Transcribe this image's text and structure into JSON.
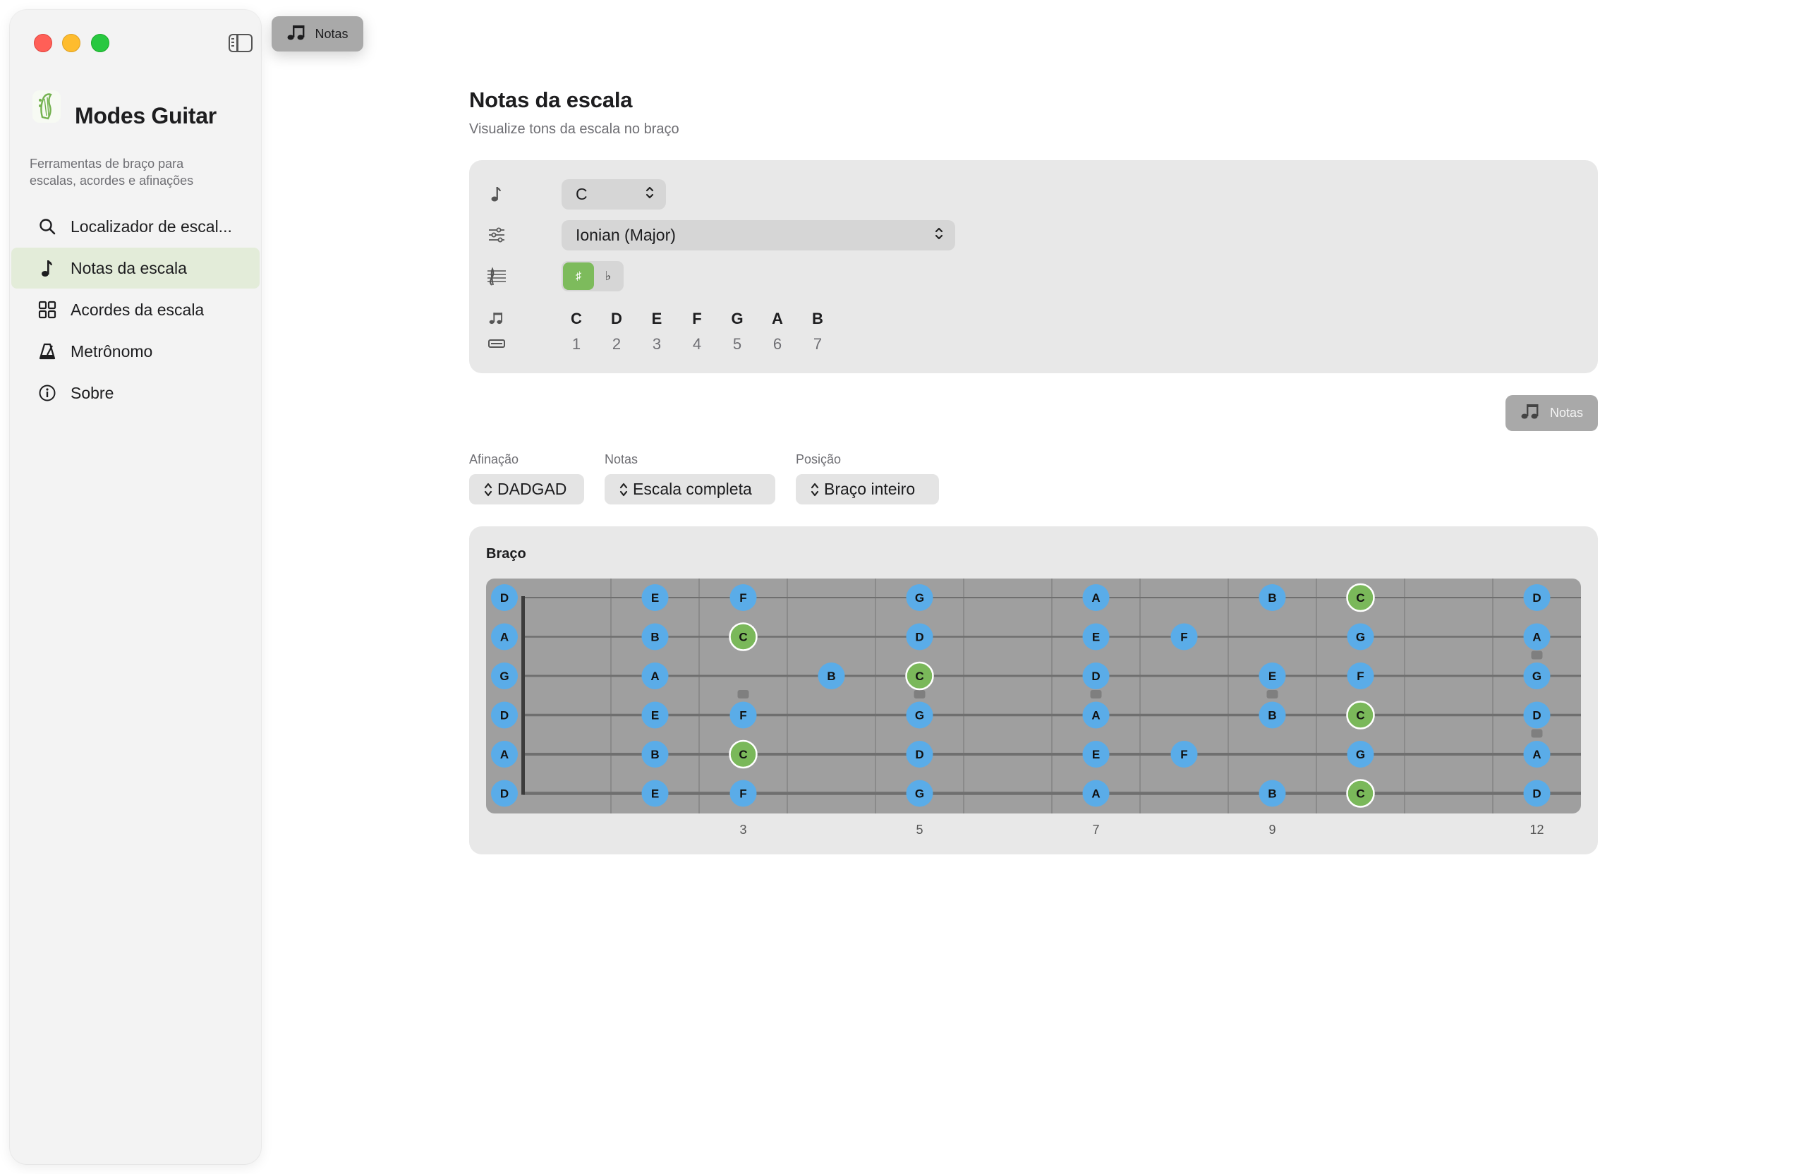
{
  "toolbar": {
    "notas_label": "Notas"
  },
  "sidebar": {
    "app_title": "Modes Guitar",
    "app_subtitle": "Ferramentas de braço para escalas, acordes e afinações",
    "items": [
      {
        "label": "Localizador de escal...",
        "icon": "search-icon"
      },
      {
        "label": "Notas da escala",
        "icon": "music-note-icon",
        "active": true
      },
      {
        "label": "Acordes da escala",
        "icon": "grid-icon"
      },
      {
        "label": "Metrônomo",
        "icon": "metronome-icon"
      },
      {
        "label": "Sobre",
        "icon": "info-icon"
      }
    ]
  },
  "main": {
    "title": "Notas da escala",
    "subtitle": "Visualize tons da escala no braço",
    "controls": {
      "root": "C",
      "mode": "Ionian (Major)",
      "accidental_sharp": "♯",
      "accidental_flat": "♭",
      "accidental_selected": "sharp",
      "scale_notes": [
        "C",
        "D",
        "E",
        "F",
        "G",
        "A",
        "B"
      ],
      "degrees": [
        "1",
        "2",
        "3",
        "4",
        "5",
        "6",
        "7"
      ]
    },
    "notas_button": "Notas",
    "options": {
      "tuning_label": "Afinação",
      "tuning_value": "DADGAD",
      "notes_label": "Notas",
      "notes_value": "Escala completa",
      "position_label": "Posição",
      "position_value": "Braço inteiro"
    },
    "fretboard": {
      "title": "Braço",
      "frets": 12,
      "strings_top_to_bottom": [
        "D",
        "A",
        "G",
        "D",
        "A",
        "D"
      ],
      "root_note": "C",
      "scale_notes": [
        "C",
        "D",
        "E",
        "F",
        "G",
        "A",
        "B"
      ],
      "fret_markers": [
        3,
        5,
        7,
        9,
        12
      ],
      "colors": {
        "board": "#9f9f9f",
        "note": "#5aace8",
        "root": "#7ab85a",
        "accent": "#7dbb5c"
      }
    }
  }
}
